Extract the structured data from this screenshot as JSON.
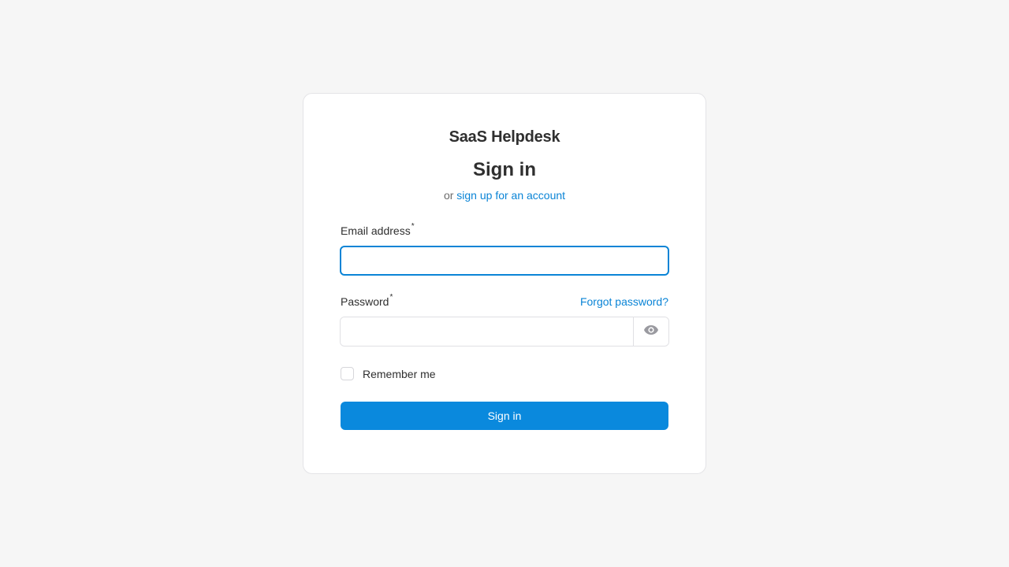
{
  "brand": {
    "name": "SaaS Helpdesk"
  },
  "form": {
    "title": "Sign in",
    "alt_prefix": "or",
    "signup_link": "sign up for an account",
    "email": {
      "label": "Email address",
      "required_mark": "*",
      "value": "",
      "placeholder": ""
    },
    "password": {
      "label": "Password",
      "required_mark": "*",
      "value": "",
      "placeholder": "",
      "forgot_link": "Forgot password?",
      "toggle_icon": "eye-icon"
    },
    "remember": {
      "label": "Remember me",
      "checked": false
    },
    "submit_label": "Sign in"
  },
  "colors": {
    "accent": "#0a89dd",
    "link": "#0a84d6",
    "background": "#f6f6f6"
  }
}
